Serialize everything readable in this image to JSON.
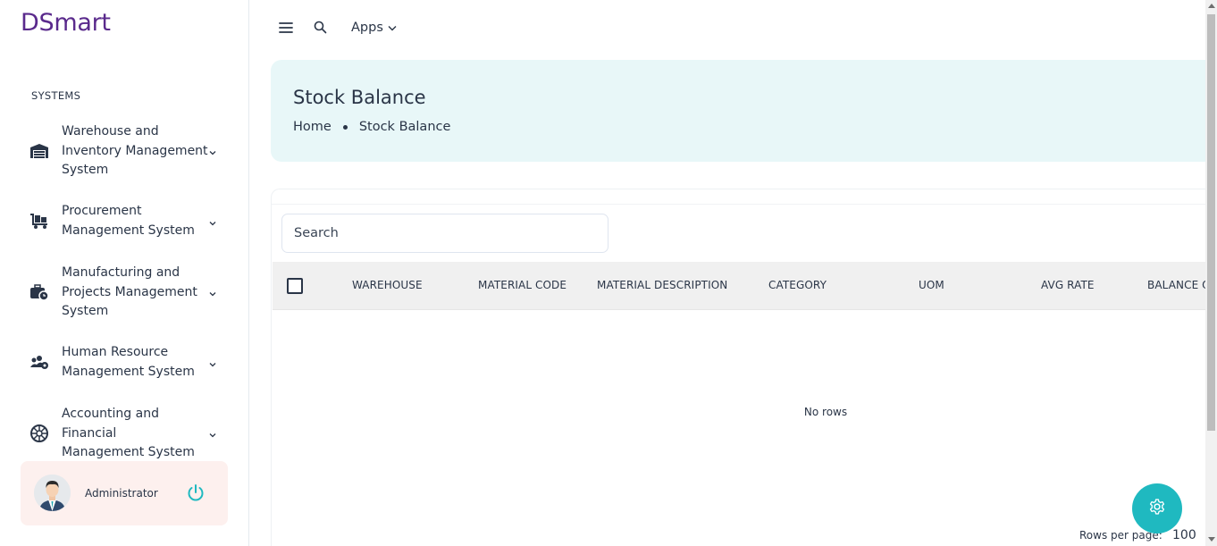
{
  "app": {
    "logo": "DSmart"
  },
  "sidebar": {
    "caption": "SYSTEMS",
    "items": [
      {
        "label": "Warehouse and\nInventory Management\nSystem",
        "icon": "warehouse-icon"
      },
      {
        "label": "Procurement\nManagement System",
        "icon": "cart-flatbed-icon"
      },
      {
        "label": "Manufacturing and\nProjects Management\nSystem",
        "icon": "briefcase-clock-icon"
      },
      {
        "label": "Human Resource\nManagement System",
        "icon": "users-gear-icon"
      },
      {
        "label": "Accounting and Financial\nManagement System",
        "icon": "aperture-icon"
      }
    ]
  },
  "user": {
    "name": "Administrator"
  },
  "topbar": {
    "apps_label": "Apps"
  },
  "page": {
    "title": "Stock Balance",
    "breadcrumb": [
      "Home",
      "Stock Balance"
    ]
  },
  "search": {
    "placeholder": "Search"
  },
  "table": {
    "columns": [
      "WAREHOUSE",
      "MATERIAL CODE",
      "MATERIAL DESCRIPTION",
      "CATEGORY",
      "UOM",
      "AVG RATE",
      "BALANCE Q"
    ],
    "empty_text": "No rows",
    "rows_per_page_label": "Rows per page:",
    "rows_per_page_value": "100"
  },
  "colors": {
    "brand": "#5a2a8c",
    "accent": "#1fb9c0",
    "header_bg": "#e8f7f8"
  }
}
